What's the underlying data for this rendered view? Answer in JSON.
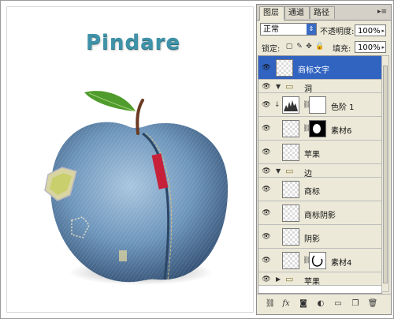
{
  "canvas": {
    "logo_text": "Pindare"
  },
  "panel": {
    "tabs": [
      {
        "label": "图层",
        "active": true
      },
      {
        "label": "通道",
        "active": false
      },
      {
        "label": "路径",
        "active": false
      }
    ],
    "menu_icon": "panel-menu-icon",
    "blend_mode": "正常",
    "opacity_label": "不透明度:",
    "opacity_value": "100%",
    "lock_label": "锁定:",
    "fill_label": "填充:",
    "fill_value": "100%",
    "layers": [
      {
        "name": "商标文字",
        "type": "layer",
        "selected": true,
        "visible": true
      },
      {
        "name": "洞",
        "type": "group",
        "expanded": true,
        "visible": true
      },
      {
        "name": "色阶 1",
        "type": "adjustment",
        "visible": true
      },
      {
        "name": "素材6",
        "type": "layer-mask",
        "visible": true
      },
      {
        "name": "苹果",
        "type": "layer",
        "visible": true
      },
      {
        "name": "边",
        "type": "group",
        "expanded": true,
        "visible": true
      },
      {
        "name": "商标",
        "type": "layer",
        "visible": true
      },
      {
        "name": "商标阴影",
        "type": "layer",
        "visible": true
      },
      {
        "name": "阴影",
        "type": "layer",
        "visible": true
      },
      {
        "name": "素材4",
        "type": "layer-mask",
        "visible": true
      },
      {
        "name": "苹果",
        "type": "group",
        "expanded": false,
        "visible": true
      }
    ],
    "bottom_icons": [
      "link-icon",
      "fx-icon",
      "mask-icon",
      "adjustment-icon",
      "group-icon",
      "new-layer-icon",
      "trash-icon"
    ],
    "colors": {
      "selected": "#3164c1",
      "panel_bg": "#ece9d8"
    }
  }
}
